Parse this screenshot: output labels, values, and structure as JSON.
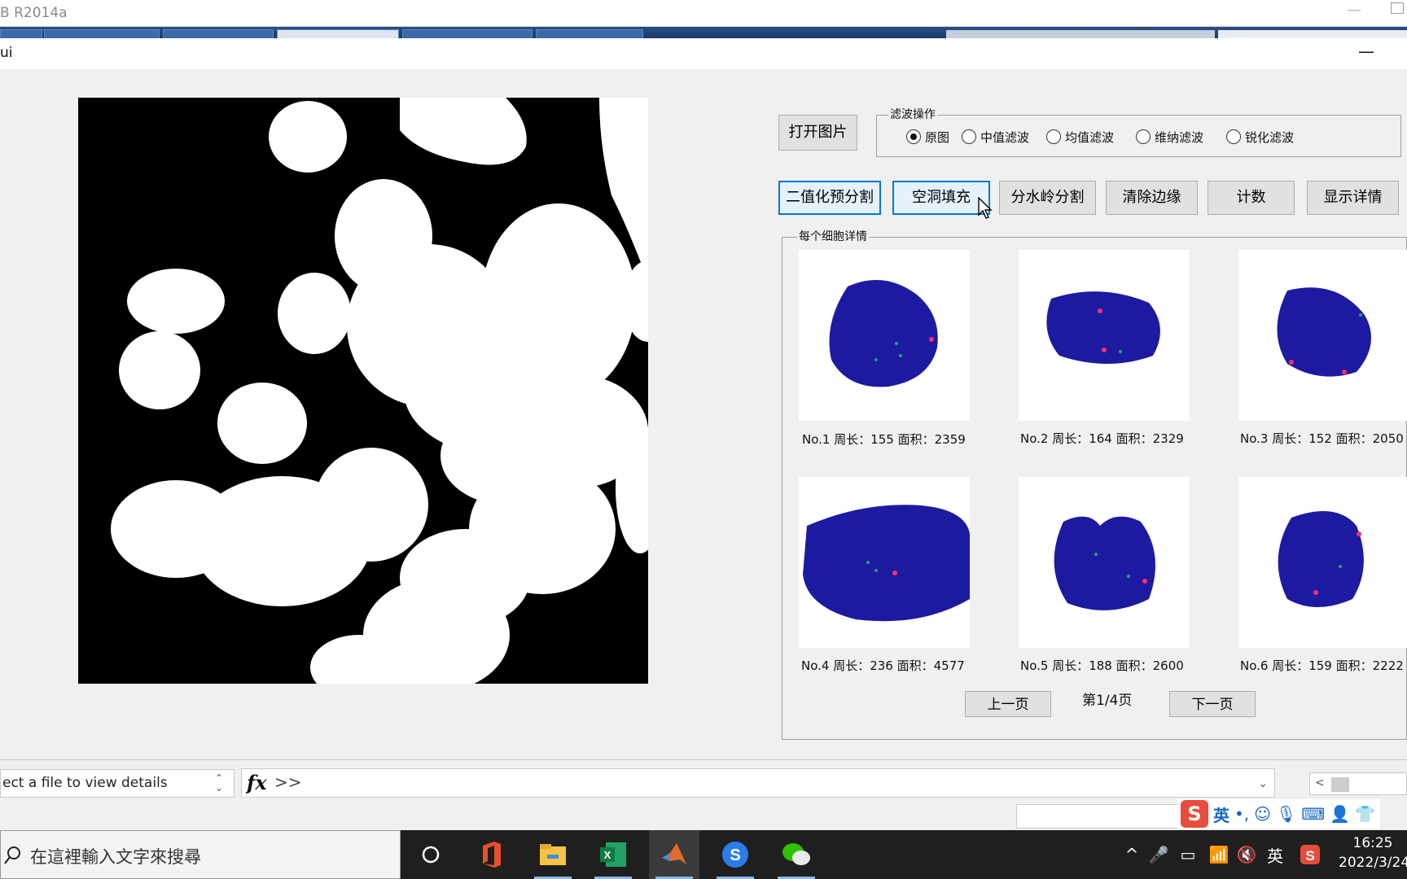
{
  "matlab_window": {
    "title": "B R2014a"
  },
  "figure_window": {
    "title": "ui"
  },
  "toolbar": {
    "open_image": "打开图片",
    "filter_group": {
      "title": "滤波操作",
      "options": [
        "原图",
        "中值滤波",
        "均值滤波",
        "维纳滤波",
        "锐化滤波"
      ],
      "selected": "原图"
    },
    "actions": [
      "二值化预分割",
      "空洞填充",
      "分水岭分割",
      "清除边缘",
      "计数",
      "显示详情"
    ],
    "focused_action": "空洞填充"
  },
  "details_panel": {
    "title": "每个细胞详情",
    "cells": [
      {
        "caption": "No.1 周长：155 面积：2359"
      },
      {
        "caption": "No.2 周长：164 面积：2329"
      },
      {
        "caption": "No.3 周长：152 面积：2050"
      },
      {
        "caption": "No.4 周长：236 面积：4577"
      },
      {
        "caption": "No.5 周长：188 面积：2600"
      },
      {
        "caption": "No.6 周长：159 面积：2222"
      }
    ],
    "prev_page": "上一页",
    "page_label": "第1/4页",
    "next_page": "下一页"
  },
  "command_bar": {
    "details_text": "ect a file to view details",
    "fx_label": "fx",
    "prompt": ">>"
  },
  "ime_bar": {
    "logo": "S",
    "mode": "英",
    "punct": "•,"
  },
  "taskbar": {
    "search_placeholder": "在這裡輸入文字來搜尋",
    "apps": [
      "cortana-icon",
      "office-icon",
      "file-explorer-icon",
      "excel-icon",
      "matlab-icon",
      "sogou-icon",
      "wechat-icon"
    ],
    "ime_indicator": "英",
    "time": "16:25",
    "date": "2022/3/24"
  },
  "colors": {
    "accent": "#0078d7",
    "cell_blue": "#1c1aa0",
    "taskbar": "#1f1f1f"
  }
}
